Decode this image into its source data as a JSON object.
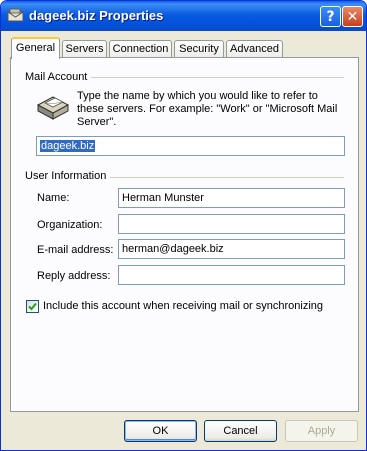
{
  "window": {
    "title": "dageek.biz Properties"
  },
  "titlebar": {
    "help_glyph": "?",
    "close_glyph": "✕"
  },
  "tabs": [
    {
      "label": "General",
      "active": true
    },
    {
      "label": "Servers",
      "active": false
    },
    {
      "label": "Connection",
      "active": false
    },
    {
      "label": "Security",
      "active": false
    },
    {
      "label": "Advanced",
      "active": false
    }
  ],
  "mail_account": {
    "group_label": "Mail Account",
    "description": "Type the name by which you would like to refer to these servers.  For example: \"Work\" or \"Microsoft Mail Server\".",
    "account_name": "dageek.biz"
  },
  "user_information": {
    "group_label": "User Information",
    "fields": {
      "name": {
        "label": "Name:",
        "value": "Herman Munster"
      },
      "organization": {
        "label": "Organization:",
        "value": ""
      },
      "email": {
        "label": "E-mail address:",
        "value": "herman@dageek.biz"
      },
      "reply": {
        "label": "Reply address:",
        "value": ""
      }
    }
  },
  "include_account": {
    "label": "Include this account when receiving mail or synchronizing",
    "checked": true
  },
  "buttons": {
    "ok": "OK",
    "cancel": "Cancel",
    "apply": "Apply"
  },
  "colors": {
    "titlebar": "#0251d8",
    "dialog_bg": "#ece9d8",
    "tab_highlight": "#ffc83c",
    "selection": "#316ac5"
  },
  "icons": {
    "title": "mail-properties-icon",
    "account": "mail-account-icon",
    "check": "check-icon"
  }
}
